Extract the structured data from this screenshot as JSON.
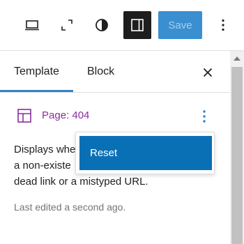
{
  "toolbar": {
    "icons": {
      "preview": "desktop-preview-icon",
      "fullscreen": "fullscreen-icon",
      "styles": "contrast-styles-icon",
      "settings": "sidebar-settings-icon",
      "more": "more-vertical-icon"
    },
    "save_label": "Save",
    "colors": {
      "settings_active_bg": "#1e1e1e",
      "save_bg": "#3a8fd0",
      "save_text": "#a9cfea"
    }
  },
  "sidebar": {
    "tabs": [
      {
        "label": "Template",
        "active": true
      },
      {
        "label": "Block",
        "active": false
      }
    ],
    "close_icon": "close-icon",
    "template": {
      "icon": "layout-template-icon",
      "title": "Page: 404",
      "title_color": "#8a2ca2",
      "options_icon": "more-vertical-icon",
      "description": "Displays when a visitor views a non-existent page, such as a dead link or a mistyped URL.",
      "description_visible_lines": [
        "Displays whe",
        "a non-existe",
        "dead link or a mistyped URL."
      ],
      "last_edited": "Last edited a second ago."
    }
  },
  "dropdown": {
    "items": [
      {
        "label": "Reset"
      }
    ],
    "highlight_color": "#0a70b5"
  }
}
